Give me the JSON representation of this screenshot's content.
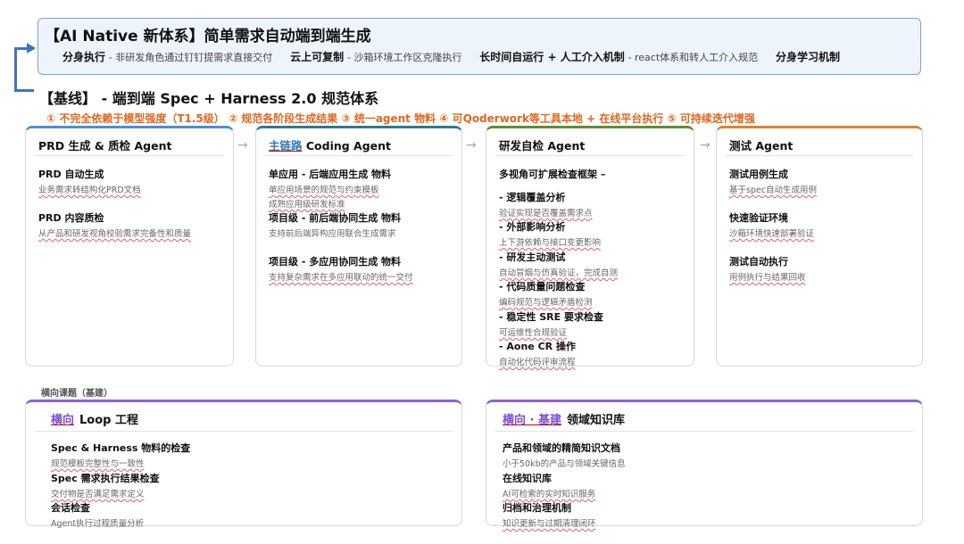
{
  "native": {
    "title": "【AI Native 新体系】简单需求自动端到端生成",
    "items": [
      {
        "key": "分身执行",
        "desc": "- 非研发角色通过钉钉提需求直接交付"
      },
      {
        "key": "云上可复制",
        "desc": "- 沙箱环境工作区克隆执行"
      },
      {
        "key": "长时间自运行 + 人工介入机制",
        "desc": "-  react体系和转人工介入规范"
      },
      {
        "key": "分身学习机制",
        "desc": ""
      }
    ]
  },
  "baseline": {
    "title": "【基线】 - 端到端 Spec + Harness 2.0 规范体系",
    "principles": "① 不完全依赖于模型强度（T1.5级） ② 规范各阶段生成结果 ③ 统一agent 物料 ④ 可Qoderwork等工具本地 + 在线平台执行 ⑤ 可持续迭代增强"
  },
  "colors": {
    "prd": "#4a8fd6",
    "coding": "#2a7d8c",
    "review": "#5e8e35",
    "test": "#e0812c",
    "cross": "#8c5fe0",
    "principle": "#e0671e"
  },
  "cards": {
    "prd": {
      "head": "PRD 生成 & 质检 Agent",
      "items": [
        {
          "title": "PRD 自动生成",
          "desc": "业务需求转结构化PRD文档"
        },
        {
          "title": "PRD 内容质检",
          "desc": "从产品和研发视角校验需求完备性和质量"
        }
      ]
    },
    "coding": {
      "head_hl": "主链路",
      "head_rest": " Coding Agent",
      "items": [
        {
          "title": "单应用 - 后端应用生成 物料",
          "desc": "单应用场景的规范与约束模板",
          "desc2": "成熟应用级研发标准"
        },
        {
          "title": "项目级 - 前后端协同生成 物料",
          "desc": "支持前后端异构应用联合生成需求"
        },
        {
          "title": "项目级 - 多应用协同生成 物料",
          "desc": "支持复杂需求在多应用联动的统一交付"
        }
      ]
    },
    "review": {
      "head": "研发自检 Agent",
      "lead": "多视角可扩展检查框架 –",
      "items": [
        {
          "title": "- 逻辑覆盖分析",
          "desc": "验证实现是否覆盖需求点"
        },
        {
          "title": "- 外部影响分析",
          "desc": "上下游依赖与接口变更影响"
        },
        {
          "title": "- 研发主动测试",
          "desc": "自动冒烟与仿真验证，完成自测"
        },
        {
          "title": "- 代码质量问题检查",
          "desc": "编码规范与逻辑矛盾检测"
        },
        {
          "title": "- 稳定性 SRE 要求检查",
          "desc": "可运维性合规验证"
        },
        {
          "title": "- Aone CR 操作",
          "desc": "自动化代码评审流程"
        }
      ]
    },
    "test": {
      "head": "测试 Agent",
      "items": [
        {
          "title": "测试用例生成",
          "desc": "基于spec自动生成用例"
        },
        {
          "title": "快速验证环境",
          "desc": "沙箱环境快速部署验证"
        },
        {
          "title": "测试自动执行",
          "desc": "用例执行与结果回收"
        }
      ]
    }
  },
  "cross": {
    "label": "横向课题（基建）",
    "loop": {
      "head_hl": "横向",
      "head_rest": "Loop 工程",
      "items": [
        {
          "title": "Spec & Harness 物料的检查",
          "desc": "规范模板完整性与一致性"
        },
        {
          "title": "Spec 需求执行结果检查",
          "desc": "交付物是否满足需求定义"
        },
        {
          "title": "会话检查",
          "desc": "Agent执行过程质量分析"
        }
      ]
    },
    "kb": {
      "head_hl": "横向 · 基建",
      "head_rest": "领域知识库",
      "items": [
        {
          "title": "产品和领域的精简知识文档",
          "desc": "小于50kb的产品与领域关键信息"
        },
        {
          "title": "在线知识库",
          "desc": "AI可检索的实时知识服务"
        },
        {
          "title": "归档和治理机制",
          "desc": "知识更新与过期清理闭环"
        }
      ]
    }
  },
  "icons": {
    "flow_arrow": "→"
  }
}
